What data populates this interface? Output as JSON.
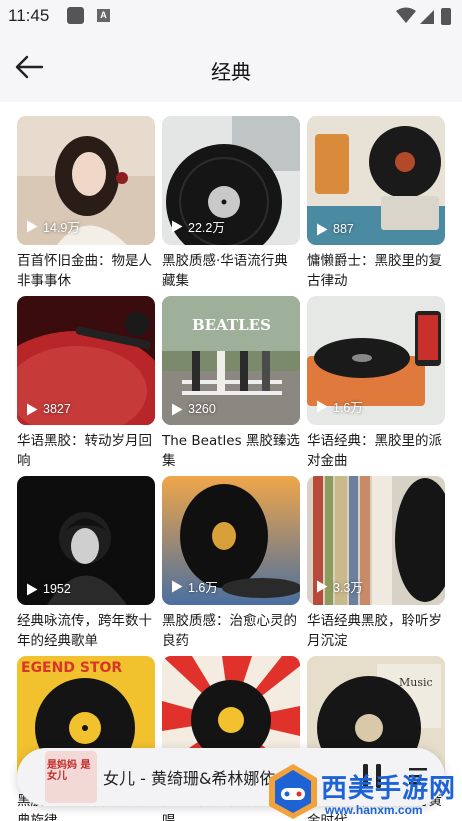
{
  "status_bar": {
    "time": "11:45",
    "app_letter": "A"
  },
  "header": {
    "title": "经典"
  },
  "cards": [
    {
      "title": "百首怀旧金曲：物是人非事事休",
      "plays": "14.9万"
    },
    {
      "title": "黑胶质感·华语流行典藏集",
      "plays": "22.2万"
    },
    {
      "title": "慵懒爵士：黑胶里的复古律动",
      "plays": "887"
    },
    {
      "title": "华语黑胶：转动岁月回响",
      "plays": "3827"
    },
    {
      "title": "The Beatles 黑胶臻选集",
      "plays": "3260"
    },
    {
      "title": "华语经典：黑胶里的派对金曲",
      "plays": "1.6万"
    },
    {
      "title": "经典咏流传，跨年数十年的经典歌单",
      "plays": "1952"
    },
    {
      "title": "黑胶质感：治愈心灵的良药",
      "plays": "1.6万"
    },
    {
      "title": "华语经典黑胶，聆听岁月沉淀",
      "plays": "3.3万"
    },
    {
      "title": "黑胶质感：解锁欧美经典旋律",
      "plays": ""
    },
    {
      "title": "传奇摇滚：黑胶版城开唱",
      "plays": ""
    },
    {
      "title": "华语经典，华语流行黄金时代",
      "plays": ""
    }
  ],
  "player": {
    "title": "女儿 - 黄绮珊&希林娜依·高",
    "cover_text": "是妈妈 是女儿"
  },
  "watermark": {
    "text": "西美手游网",
    "url": "www.hanxm.com"
  },
  "colors": {
    "accent": "#1e63d6",
    "background": "#ffffff",
    "bar": "#f6f6f9"
  }
}
